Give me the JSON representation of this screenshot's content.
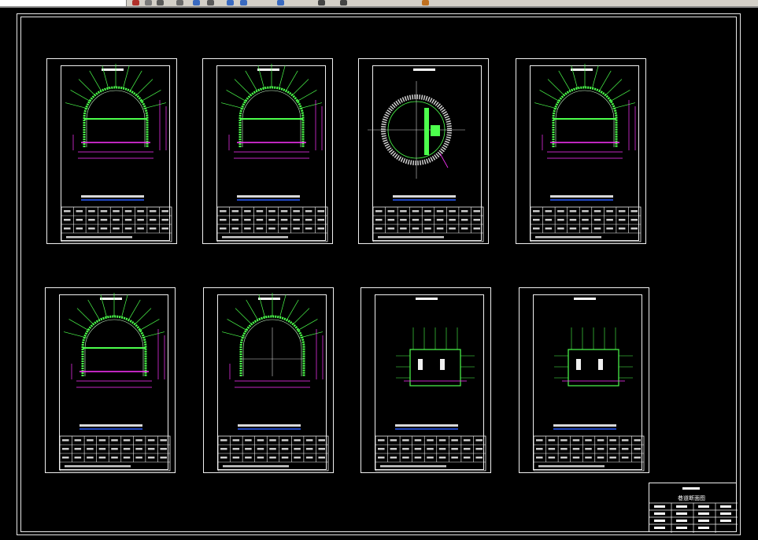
{
  "app": {
    "title_block_label": "巷道断面图",
    "colors": {
      "background": "#000000",
      "frame": "#e8e8e8",
      "profile": "#4cff4c",
      "dimension": "#ff33ff",
      "text_line": "#2a5cff",
      "table": "#f0f0f0"
    }
  },
  "toolbar": {
    "icons": [
      "open-icon",
      "save-icon",
      "undo-icon",
      "redo-icon",
      "pan-icon",
      "zoom-icon",
      "layer-icon",
      "line-icon",
      "rect-icon",
      "text-icon",
      "dimension-icon",
      "color-icon"
    ]
  },
  "sheets": [
    {
      "id": "sheet-1",
      "shape": "arch"
    },
    {
      "id": "sheet-2",
      "shape": "arch"
    },
    {
      "id": "sheet-3",
      "shape": "circle"
    },
    {
      "id": "sheet-4",
      "shape": "arch"
    },
    {
      "id": "sheet-5",
      "shape": "arch"
    },
    {
      "id": "sheet-6",
      "shape": "arch-plain"
    },
    {
      "id": "sheet-7",
      "shape": "rect"
    },
    {
      "id": "sheet-8",
      "shape": "rect"
    }
  ]
}
